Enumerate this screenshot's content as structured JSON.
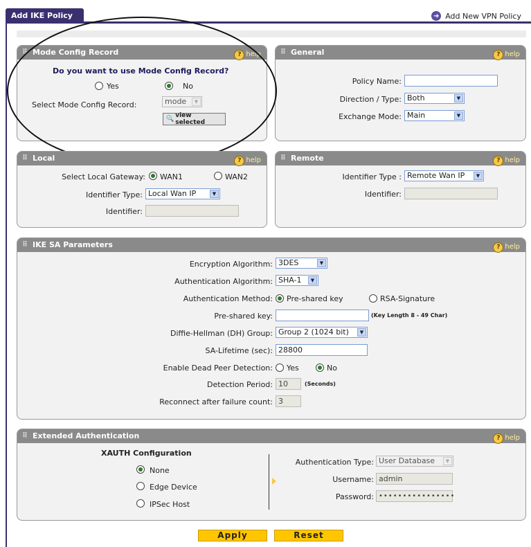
{
  "tab_title": "Add IKE Policy",
  "add_vpn_link": "Add New VPN Policy",
  "help_label": "help",
  "mode_config": {
    "header": "Mode Config Record",
    "question": "Do you want to use Mode Config Record?",
    "yes": "Yes",
    "no": "No",
    "select_label": "Select Mode Config Record:",
    "select_value": "mode",
    "view_button": "view selected"
  },
  "general": {
    "header": "General",
    "policy_name_label": "Policy Name:",
    "policy_name_value": "",
    "direction_label": "Direction / Type:",
    "direction_value": "Both",
    "exchange_label": "Exchange Mode:",
    "exchange_value": "Main"
  },
  "local": {
    "header": "Local",
    "gateway_label": "Select Local Gateway:",
    "wan1": "WAN1",
    "wan2": "WAN2",
    "identifier_type_label": "Identifier Type:",
    "identifier_type_value": "Local Wan IP",
    "identifier_label": "Identifier:",
    "identifier_value": ""
  },
  "remote": {
    "header": "Remote",
    "identifier_type_label": "Identifier Type :",
    "identifier_type_value": "Remote Wan IP",
    "identifier_label": "Identifier:",
    "identifier_value": ""
  },
  "ike_sa": {
    "header": "IKE SA Parameters",
    "encryption_label": "Encryption Algorithm:",
    "encryption_value": "3DES",
    "auth_alg_label": "Authentication Algorithm:",
    "auth_alg_value": "SHA-1",
    "auth_method_label": "Authentication Method:",
    "auth_method_psk": "Pre-shared key",
    "auth_method_rsa": "RSA-Signature",
    "psk_label": "Pre-shared key:",
    "psk_value": "",
    "psk_hint": "(Key Length 8 - 49 Char)",
    "dh_label": "Diffie-Hellman (DH) Group:",
    "dh_value": "Group 2 (1024 bit)",
    "lifetime_label": "SA-Lifetime (sec):",
    "lifetime_value": "28800",
    "dpd_label": "Enable Dead Peer Detection:",
    "dpd_yes": "Yes",
    "dpd_no": "No",
    "detection_label": "Detection Period:",
    "detection_value": "10",
    "detection_unit": "(Seconds)",
    "reconnect_label": "Reconnect after failure count:",
    "reconnect_value": "3"
  },
  "xauth": {
    "header": "Extended Authentication",
    "config_title": "XAUTH Configuration",
    "none": "None",
    "edge": "Edge Device",
    "ipsec": "IPSec Host",
    "auth_type_label": "Authentication Type:",
    "auth_type_value": "User Database",
    "username_label": "Username:",
    "username_value": "admin",
    "password_label": "Password:",
    "password_value": "••••••••••••••••"
  },
  "buttons": {
    "apply": "Apply",
    "reset": "Reset"
  }
}
